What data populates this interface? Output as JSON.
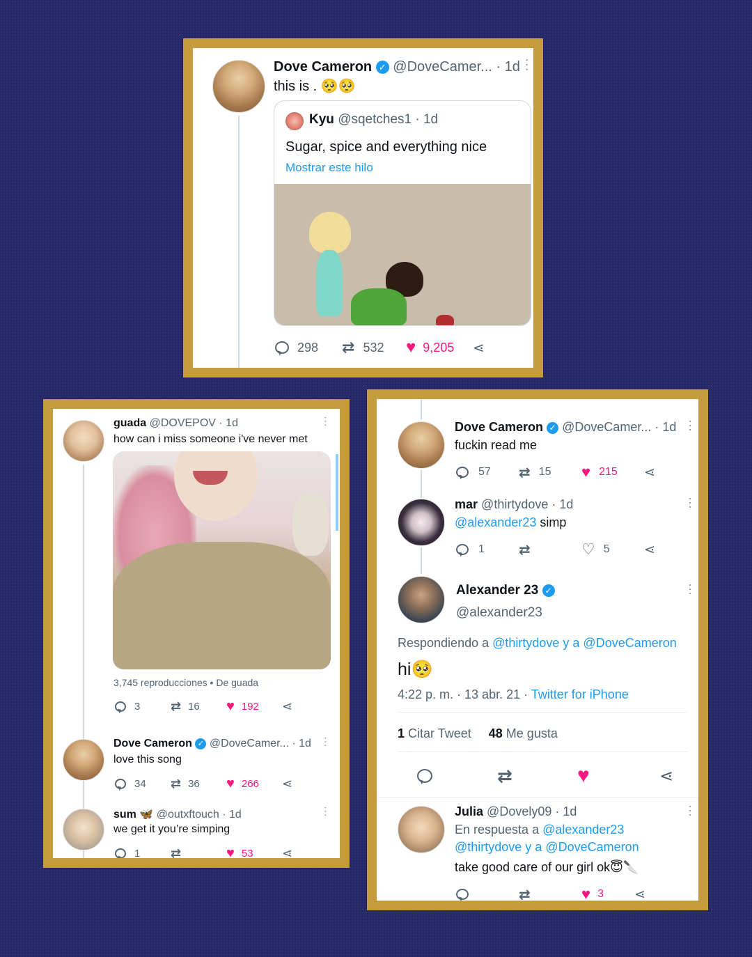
{
  "colors": {
    "background": "#262a6b",
    "frame": "#c69b3c",
    "link": "#1d9bf0",
    "like": "#f91880",
    "text_secondary": "#536471"
  },
  "panel1": {
    "tweet": {
      "name": "Dove Cameron",
      "handle": "@DoveCamer...",
      "time": "· 1d",
      "text": "this is . 🥺🥺",
      "replies": "298",
      "retweets": "532",
      "likes": "9,205"
    },
    "quote": {
      "name": "Kyu",
      "handle": "@sqetches1",
      "time": "· 1d",
      "text": "Sugar, spice and everything nice",
      "show_thread": "Mostrar este hilo"
    }
  },
  "panel2": {
    "tweet1": {
      "name": "guada",
      "handle": "@DOVEPOV",
      "time": "· 1d",
      "text": "how can i miss someone i've never met",
      "views": "3,745 reproducciones",
      "source": "• De guada",
      "replies": "3",
      "retweets": "16",
      "likes": "192"
    },
    "tweet2": {
      "name": "Dove Cameron",
      "handle": "@DoveCamer...",
      "time": "· 1d",
      "text": "love this song",
      "replies": "34",
      "retweets": "36",
      "likes": "266"
    },
    "tweet3": {
      "name": "sum 🦋",
      "handle": "@outxftouch",
      "time": "· 1d",
      "text": "we get it you’re simping",
      "replies": "1",
      "retweets": "",
      "likes": "53"
    }
  },
  "panel3": {
    "tweet1": {
      "name": "Dove Cameron",
      "handle": "@DoveCamer...",
      "time": "· 1d",
      "text": "fuckin read me",
      "replies": "57",
      "retweets": "15",
      "likes": "215"
    },
    "tweet2": {
      "name": "mar",
      "handle": "@thirtydove",
      "time": "· 1d",
      "mention": "@alexander23",
      "text": " simp",
      "replies": "1",
      "retweets": "",
      "likes": "5"
    },
    "main": {
      "name": "Alexander 23",
      "handle": "@alexander23",
      "replying_prefix": "Respondiendo a ",
      "replying_to": "@thirtydove y a @DoveCameron",
      "text": "hi🥺",
      "timestamp": "4:22 p. m. · 13 abr. 21 · ",
      "client": "Twitter for iPhone",
      "quote_count": "1",
      "quote_label": "Citar Tweet",
      "like_count": "48",
      "like_label": "Me gusta"
    },
    "reply": {
      "name": "Julia",
      "handle": "@Dovely09",
      "time": "· 1d",
      "replying_prefix": "En respuesta a ",
      "replying_line1": "@alexander23",
      "replying_line2": "@thirtydove y a @DoveCameron",
      "text": "take good care of our girl ok😇🔪",
      "likes": "3"
    }
  }
}
